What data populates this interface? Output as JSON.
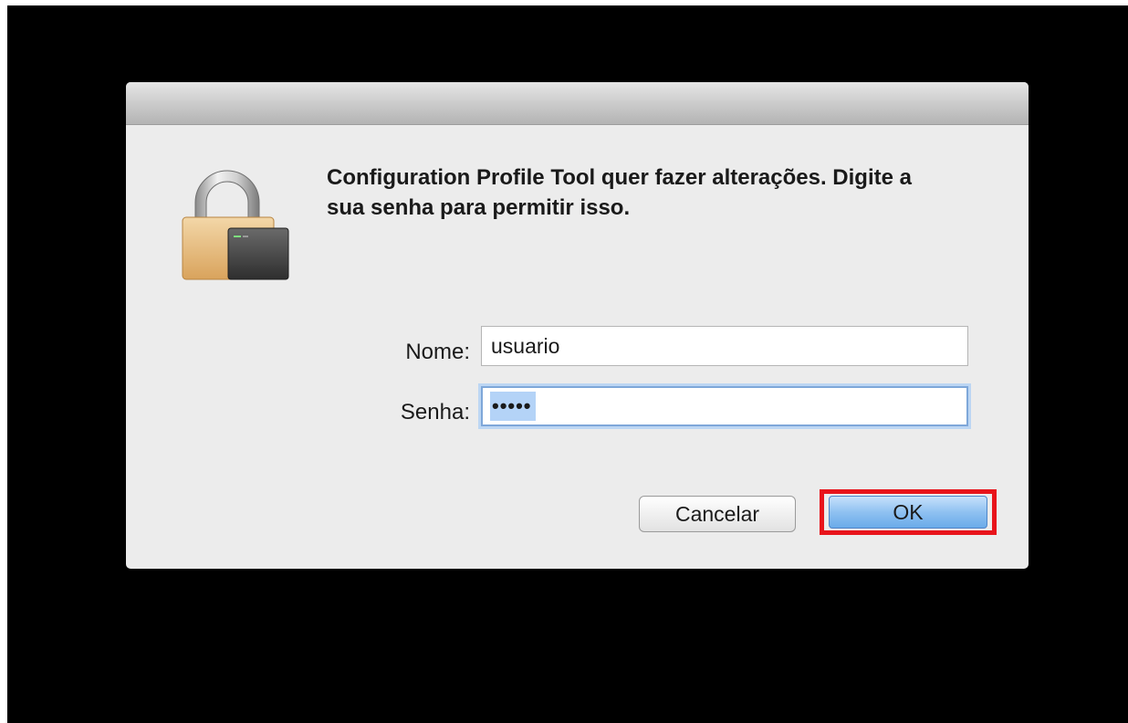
{
  "dialog": {
    "message": "Configuration Profile Tool quer fazer alterações. Digite a sua senha para permitir isso.",
    "icon": "lock-icon"
  },
  "form": {
    "name_label": "Nome:",
    "name_value": "usuario",
    "password_label": "Senha:",
    "password_value": "•••••"
  },
  "buttons": {
    "cancel_label": "Cancelar",
    "ok_label": "OK"
  },
  "colors": {
    "highlight": "#e8141b",
    "ok_button": "#8fc1f1",
    "background": "#000000"
  }
}
